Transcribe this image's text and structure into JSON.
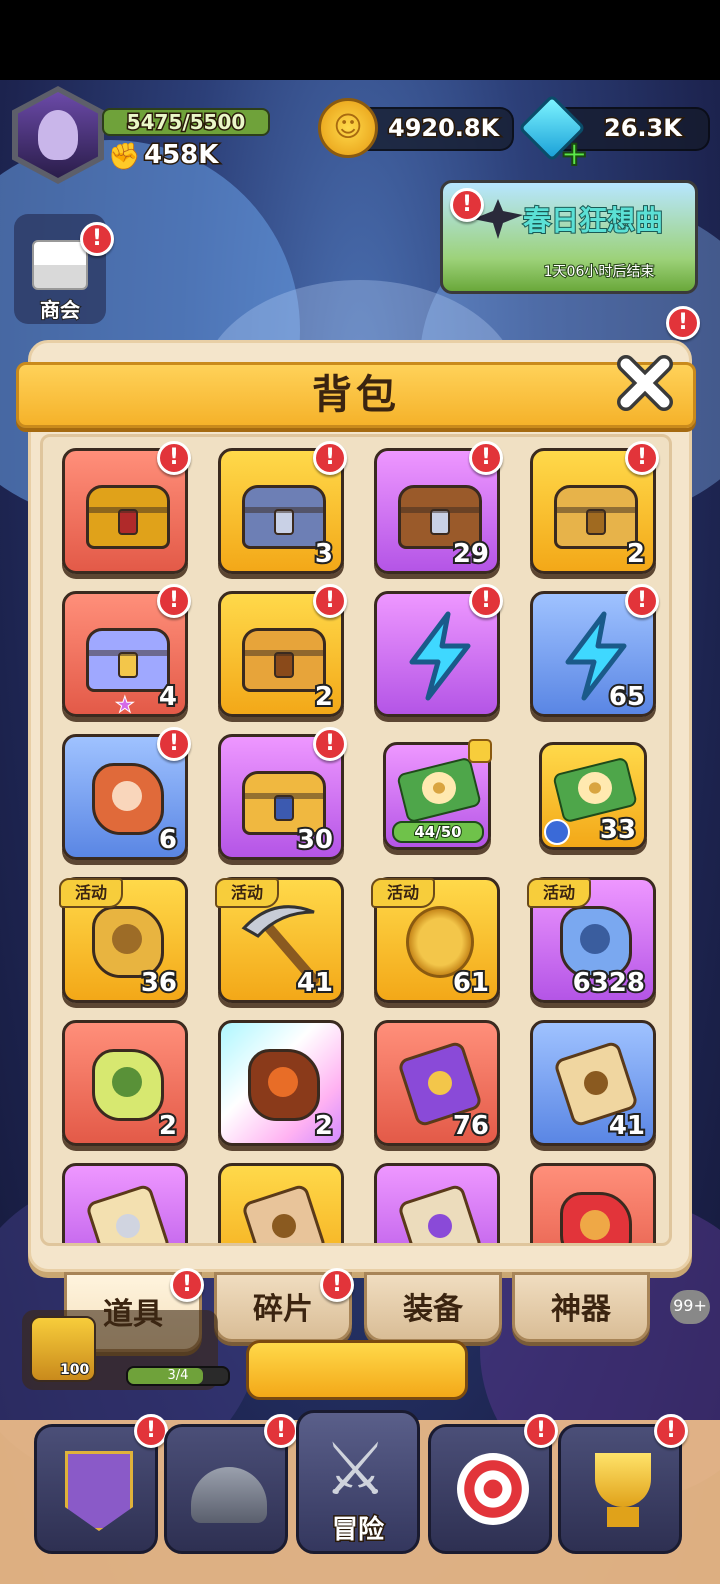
{
  "hud": {
    "energy": "5475/5500",
    "power": "458K",
    "coins": "4920.8K",
    "gems": "26.3K",
    "shop_label": "商会",
    "event_title": "春日狂想曲",
    "event_timer": "1天06小时后结束"
  },
  "backpack": {
    "title": "背包",
    "items": [
      {
        "color": "red",
        "icon": "golden-chest-icon",
        "count": "",
        "tag": "",
        "alert": true
      },
      {
        "color": "yellow",
        "icon": "blue-chest-icon",
        "count": "3",
        "tag": "",
        "alert": true
      },
      {
        "color": "purple",
        "icon": "wooden-chest-icon",
        "count": "29",
        "tag": "",
        "alert": true
      },
      {
        "color": "yellow",
        "icon": "mask-chest-icon",
        "count": "2",
        "tag": "",
        "alert": true
      },
      {
        "color": "red",
        "icon": "crystal-chest-icon",
        "count": "4",
        "tag": "",
        "alert": true,
        "star": true
      },
      {
        "color": "yellow",
        "icon": "ornate-chest-icon",
        "count": "2",
        "tag": "",
        "alert": true
      },
      {
        "color": "purple",
        "icon": "lightning-icon",
        "count": "",
        "tag": "",
        "alert": true
      },
      {
        "color": "blue",
        "icon": "lightning-icon",
        "count": "65",
        "tag": "",
        "alert": true
      },
      {
        "color": "blue",
        "icon": "meat-icon",
        "count": "6",
        "tag": "",
        "alert": true
      },
      {
        "color": "purple",
        "icon": "lion-chest-icon",
        "count": "30",
        "tag": "",
        "alert": true
      },
      {
        "color": "purple",
        "icon": "flower-ticket-icon",
        "count": "",
        "tag": "",
        "alert": false,
        "progress": "44/50",
        "small": true
      },
      {
        "color": "yellow",
        "icon": "flower-ticket-icon",
        "count": "33",
        "tag": "",
        "alert": false,
        "small": true,
        "clock": true
      },
      {
        "color": "yellow",
        "icon": "stone-tablet-icon",
        "count": "36",
        "tag": "活动",
        "alert": false
      },
      {
        "color": "yellow",
        "icon": "pickaxe-icon",
        "count": "41",
        "tag": "活动",
        "alert": false
      },
      {
        "color": "yellow",
        "icon": "gold-coin-icon",
        "count": "61",
        "tag": "活动",
        "alert": false
      },
      {
        "color": "purple",
        "icon": "crystal-ore-icon",
        "count": "6328",
        "tag": "活动",
        "alert": false
      },
      {
        "color": "red",
        "icon": "potion-icon",
        "count": "2",
        "tag": "",
        "alert": false
      },
      {
        "color": "rainbow",
        "icon": "lava-rock-icon",
        "count": "2",
        "tag": "",
        "alert": false
      },
      {
        "color": "red",
        "icon": "purple-scroll-icon",
        "count": "76",
        "tag": "",
        "alert": false
      },
      {
        "color": "blue",
        "icon": "map-scroll-icon",
        "count": "41",
        "tag": "",
        "alert": false
      },
      {
        "color": "purple",
        "icon": "viking-scroll-icon",
        "count": "",
        "tag": "",
        "alert": false
      },
      {
        "color": "yellow",
        "icon": "parchment-icon",
        "count": "",
        "tag": "",
        "alert": false
      },
      {
        "color": "purple",
        "icon": "eye-scroll-icon",
        "count": "",
        "tag": "",
        "alert": false
      },
      {
        "color": "red",
        "icon": "red-card-icon",
        "count": "",
        "tag": "",
        "alert": false
      }
    ],
    "tabs": [
      {
        "label": "道具",
        "active": true,
        "alert": true
      },
      {
        "label": "碎片",
        "active": false,
        "alert": true
      },
      {
        "label": "装备",
        "active": false,
        "alert": false
      },
      {
        "label": "神器",
        "active": false,
        "alert": false
      }
    ]
  },
  "bottom": {
    "level_badge": "100",
    "quest_progress": "3/4",
    "adventure_label": "冒险",
    "side_badge": "99+"
  },
  "colors": {
    "banner": "#f5b22a",
    "alert": "#e2343a",
    "panel": "#f4e5cb"
  }
}
